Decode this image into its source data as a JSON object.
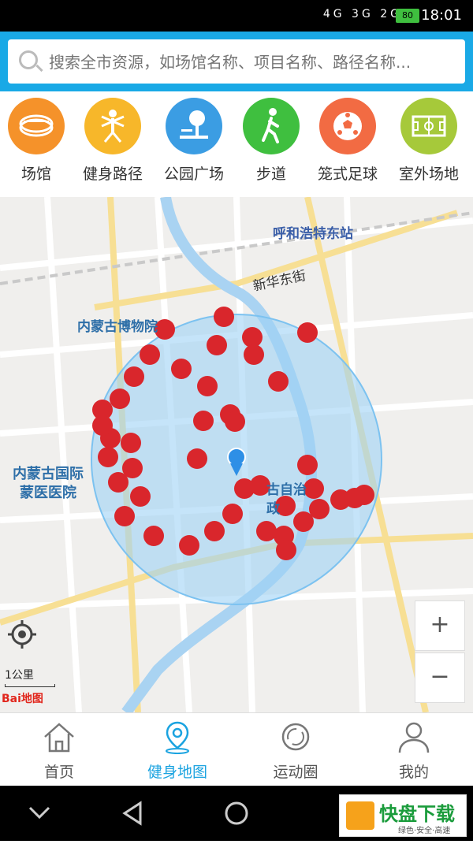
{
  "status_bar": {
    "time": "18:01",
    "battery": "80",
    "signal_text": "4G 3G 2G"
  },
  "search": {
    "placeholder": "搜索全市资源，如场馆名称、项目名称、路径名称..."
  },
  "categories": [
    {
      "label": "场馆",
      "icon": "stadium-icon",
      "color": "#f5922a"
    },
    {
      "label": "健身路径",
      "icon": "fitness-path-icon",
      "color": "#f7b72a"
    },
    {
      "label": "公园广场",
      "icon": "park-icon",
      "color": "#3b9de3"
    },
    {
      "label": "步道",
      "icon": "walking-icon",
      "color": "#3fbf3f"
    },
    {
      "label": "笼式足球",
      "icon": "soccer-icon",
      "color": "#f26b43"
    },
    {
      "label": "室外场地",
      "icon": "field-icon",
      "color": "#a6c93a"
    }
  ],
  "map": {
    "labels": {
      "station": "呼和浩特东站",
      "street": "新华东街",
      "museum": "内蒙古博物院",
      "hospital_line1": "内蒙古国际",
      "hospital_line2": "蒙医医院",
      "gov_fragment": "古自治",
      "gov_fragment2": "政"
    },
    "scale_label": "1公里",
    "baidu_logo": "Bai地图",
    "zoom_in": "+",
    "zoom_out": "−",
    "marker_color": "#d9262c",
    "radius_color": "#9fd2f5"
  },
  "tabs": [
    {
      "label": "首页",
      "icon": "home-icon",
      "active": false
    },
    {
      "label": "健身地图",
      "icon": "map-pin-icon",
      "active": true
    },
    {
      "label": "运动圈",
      "icon": "circle-refresh-icon",
      "active": false
    },
    {
      "label": "我的",
      "icon": "user-icon",
      "active": false
    }
  ],
  "watermark": {
    "title": "快盘下载",
    "subtitle": "绿色·安全·高速"
  }
}
